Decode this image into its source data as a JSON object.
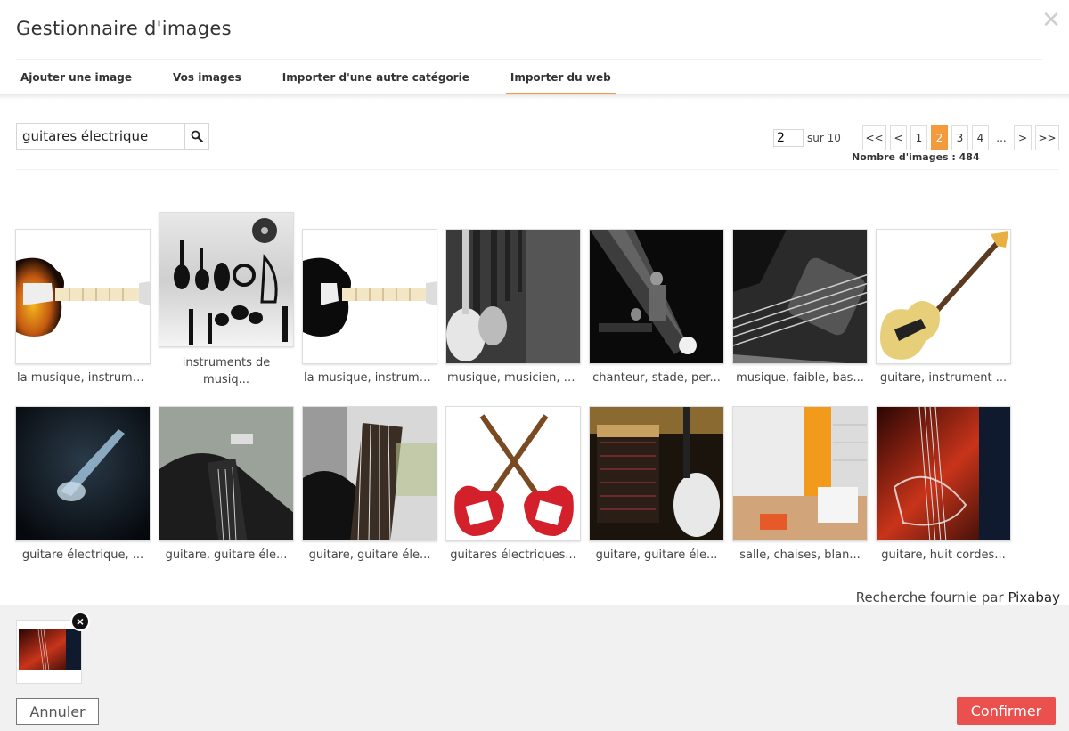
{
  "modal": {
    "title": "Gestionnaire d'images",
    "close_icon": "close-icon"
  },
  "tabs": [
    {
      "label": "Ajouter une image",
      "active": false
    },
    {
      "label": "Vos images",
      "active": false
    },
    {
      "label": "Importer d'une autre catégorie",
      "active": false
    },
    {
      "label": "Importer du web",
      "active": true
    }
  ],
  "search": {
    "value": "guitares électrique",
    "icon": "search-icon"
  },
  "pagination": {
    "current_page": "2",
    "of_total": "sur 10",
    "buttons": [
      "<<",
      "<",
      "1",
      "2",
      "3",
      "4",
      "...",
      ">",
      ">>"
    ],
    "active": "2",
    "count_text": "Nombre d'images : 484"
  },
  "accent_color": "#f39a3d",
  "results": [
    {
      "caption": "la musique, instrume..."
    },
    {
      "caption": "instruments de musiq..."
    },
    {
      "caption": "la musique, instrume..."
    },
    {
      "caption": "musique, musicien, p..."
    },
    {
      "caption": "chanteur, stade, per..."
    },
    {
      "caption": "musique, faible, bas..."
    },
    {
      "caption": "guitare, instrument ..."
    },
    {
      "caption": "guitare électrique, ..."
    },
    {
      "caption": "guitare, guitare éle..."
    },
    {
      "caption": "guitare, guitare éle..."
    },
    {
      "caption": "guitares électriques..."
    },
    {
      "caption": "guitare, guitare éle..."
    },
    {
      "caption": "salle, chaises, blan..."
    },
    {
      "caption": "guitare, huit cordes..."
    }
  ],
  "credit": {
    "prefix": "Recherche fournie par",
    "provider": "Pixabay"
  },
  "footer": {
    "remove_label": "×",
    "cancel_label": "Annuler",
    "confirm_label": "Confirmer",
    "confirm_color": "#e9504e"
  }
}
